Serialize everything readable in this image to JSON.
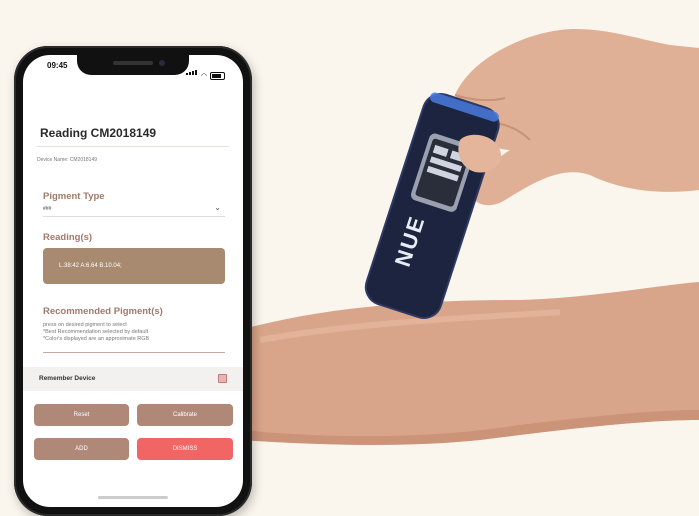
{
  "status_bar": {
    "time": "09:45"
  },
  "screen": {
    "title": "Reading CM2018149",
    "device_name": "Device Name: CM2018149",
    "pigment_type_label": "Pigment Type",
    "pigment_type_value": "###",
    "readings_label": "Reading(s)",
    "readings_value": "L.38:42 A:6.64 B.10.04;",
    "recommended_label": "Recommended Pigment(s)",
    "help_lines": [
      "press on desired pigment to select",
      "*Best Recommendation selected by default",
      "*Color's displayed are an approximate RGB"
    ],
    "remember_device_label": "Remember Device",
    "buttons": {
      "reset": "Reset",
      "calibrate": "Calibrate",
      "add": "ADD",
      "dismiss": "DISMISS"
    }
  },
  "device": {
    "brand_text": "NUE"
  },
  "colors": {
    "reading_box": "#a88a70",
    "brown_button": "#b08878",
    "dismiss_button": "#f26565",
    "label_color": "#a07a6a",
    "background": "#faf6ee"
  }
}
